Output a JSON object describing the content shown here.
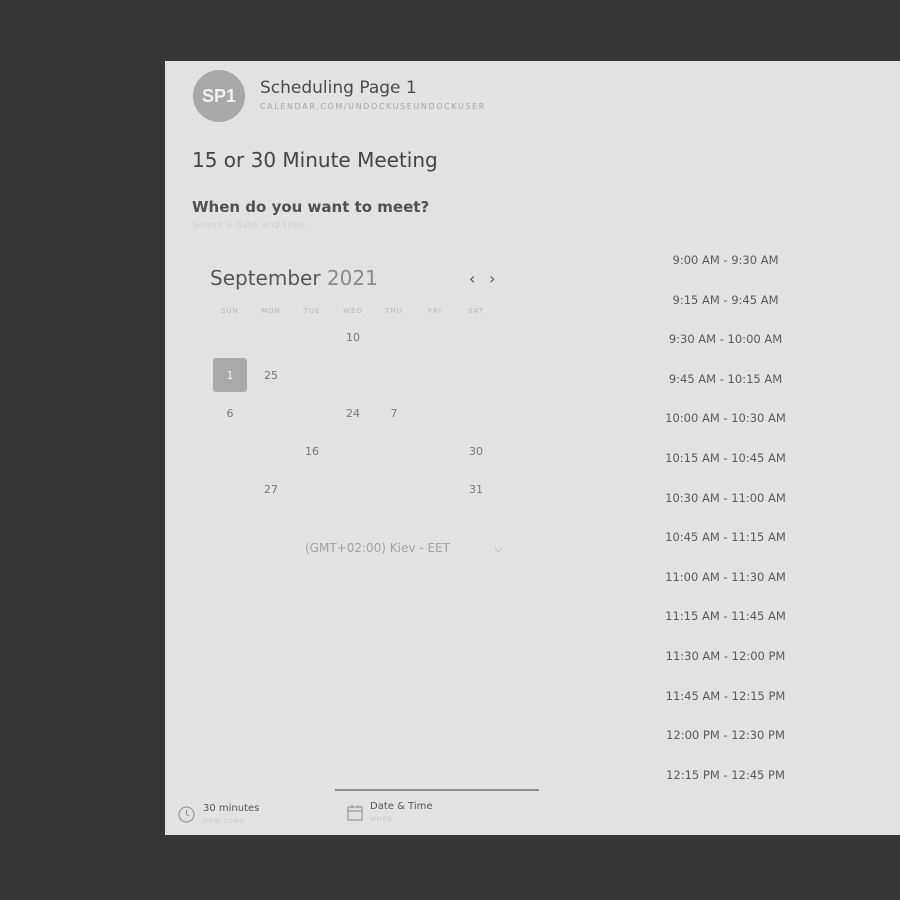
{
  "header": {
    "avatar_initials": "SP1",
    "page_name": "Scheduling Page 1",
    "page_url": "CALENDAR.COM/UNDOCKUSEUNDOCKUSER"
  },
  "meeting": {
    "title": "15 or 30 Minute Meeting",
    "question": "When do you want to meet?",
    "hint": "Select a date and time"
  },
  "calendar": {
    "month": "September",
    "year": "2021",
    "prev_label": "‹",
    "next_label": "›",
    "weekdays": [
      "SUN",
      "MON",
      "TUE",
      "WED",
      "THU",
      "FRI",
      "SAT"
    ],
    "days": [
      {
        "label": "10",
        "col": 3,
        "row": 0,
        "selected": false
      },
      {
        "label": "1",
        "col": 0,
        "row": 1,
        "selected": true
      },
      {
        "label": "25",
        "col": 1,
        "row": 1,
        "selected": false
      },
      {
        "label": "6",
        "col": 0,
        "row": 2,
        "selected": false
      },
      {
        "label": "24",
        "col": 3,
        "row": 2,
        "selected": false
      },
      {
        "label": "7",
        "col": 4,
        "row": 2,
        "selected": false
      },
      {
        "label": "16",
        "col": 2,
        "row": 3,
        "selected": false
      },
      {
        "label": "30",
        "col": 6,
        "row": 3,
        "selected": false
      },
      {
        "label": "27",
        "col": 1,
        "row": 4,
        "selected": false
      },
      {
        "label": "31",
        "col": 6,
        "row": 4,
        "selected": false
      }
    ]
  },
  "timezone": {
    "label": "(GMT+02:00) Kiev - EET",
    "chevron": "⌵"
  },
  "time_slots": [
    "9:00 AM - 9:30 AM",
    "9:15 AM - 9:45 AM",
    "9:30 AM - 10:00 AM",
    "9:45 AM - 10:15 AM",
    "10:00 AM - 10:30 AM",
    "10:15 AM - 10:45 AM",
    "10:30 AM - 11:00 AM",
    "10:45 AM - 11:15 AM",
    "11:00 AM - 11:30 AM",
    "11:15 AM - 11:45 AM",
    "11:30 AM - 12:00 PM",
    "11:45 AM - 12:15 PM",
    "12:00 PM - 12:30 PM",
    "12:15 PM - 12:45 PM"
  ],
  "footer": {
    "duration_label": "30 minutes",
    "duration_sub": "HOW LONG",
    "datetime_label": "Date & Time",
    "datetime_sub": "WHEN"
  }
}
